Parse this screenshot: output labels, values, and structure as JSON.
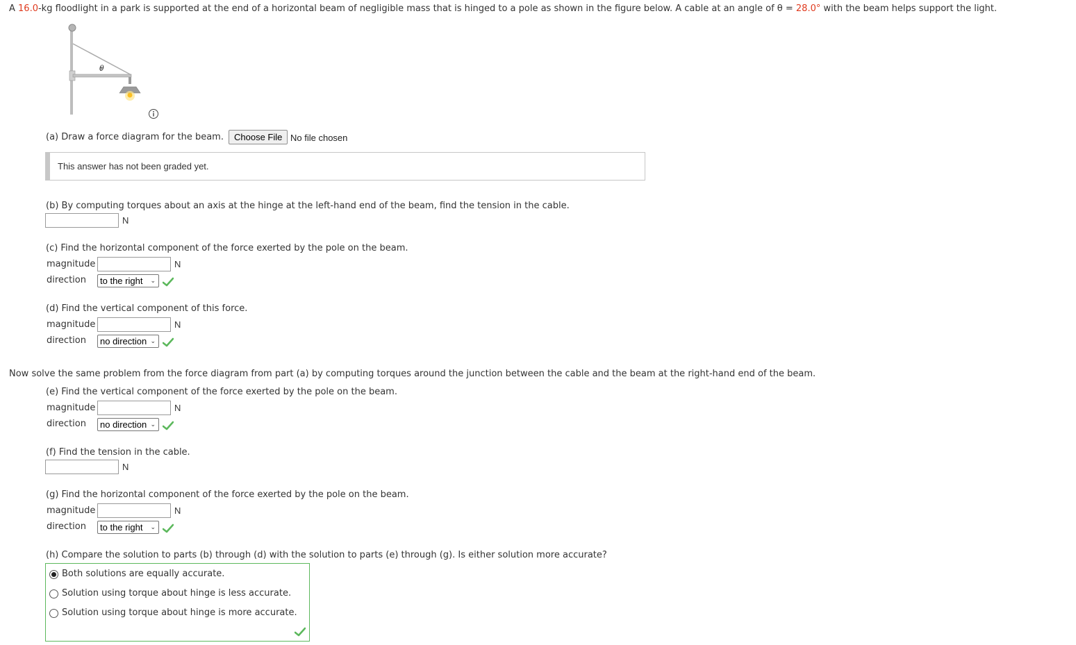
{
  "intro": {
    "p1": "A ",
    "mass": "16.0",
    "p2": "-kg floodlight in a park is supported at the end of a horizontal beam of negligible mass that is hinged to a pole as shown in the figure below. A cable at an angle of θ = ",
    "angle": "28.0°",
    "p3": " with the beam helps support the light."
  },
  "figure": {
    "theta_label": "θ"
  },
  "part_a": {
    "label": "(a) Draw a force diagram for the beam.",
    "choose_file": "Choose File",
    "no_file": "No file chosen",
    "graded": "This answer has not been graded yet."
  },
  "part_b": {
    "label": "(b) By computing torques about an axis at the hinge at the left-hand end of the beam, find the tension in the cable.",
    "unit": "N",
    "value": ""
  },
  "part_c": {
    "label": "(c) Find the horizontal component of the force exerted by the pole on the beam.",
    "magnitude_label": "magnitude",
    "direction_label": "direction",
    "unit": "N",
    "magnitude": "",
    "direction": "to the right"
  },
  "part_d": {
    "label": "(d) Find the vertical component of this force.",
    "magnitude_label": "magnitude",
    "direction_label": "direction",
    "unit": "N",
    "magnitude": "",
    "direction": "no direction"
  },
  "now_solve": "Now solve the same problem from the force diagram from part (a) by computing torques around the junction between the cable and the beam at the right-hand end of the beam.",
  "part_e": {
    "label": "(e) Find the vertical component of the force exerted by the pole on the beam.",
    "magnitude_label": "magnitude",
    "direction_label": "direction",
    "unit": "N",
    "magnitude": "",
    "direction": "no direction"
  },
  "part_f": {
    "label": "(f) Find the tension in the cable.",
    "unit": "N",
    "value": ""
  },
  "part_g": {
    "label": "(g) Find the horizontal component of the force exerted by the pole on the beam.",
    "magnitude_label": "magnitude",
    "direction_label": "direction",
    "unit": "N",
    "magnitude": "",
    "direction": "to the right"
  },
  "part_h": {
    "label": "(h) Compare the solution to parts (b) through (d) with the solution to parts (e) through (g). Is either solution more accurate?",
    "options": [
      "Both solutions are equally accurate.",
      "Solution using torque about hinge is less accurate.",
      "Solution using torque about hinge is more accurate."
    ],
    "selected_index": 0
  },
  "colors": {
    "highlight": "#e03a1e",
    "correct": "#5cb85c"
  }
}
